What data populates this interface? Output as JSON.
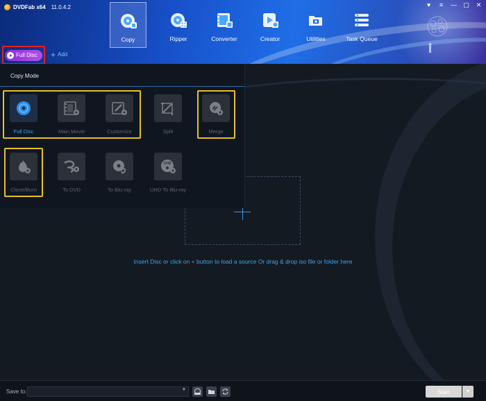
{
  "app": {
    "name": "DVDFab x64",
    "version": "11.0.4.2"
  },
  "window_controls": [
    "♥",
    "≡",
    "—",
    "▢",
    "✕"
  ],
  "nav": {
    "items": [
      {
        "label": "Copy",
        "icon": "copy-disc-icon",
        "active": true
      },
      {
        "label": "Ripper",
        "icon": "ripper-disc-icon",
        "active": false
      },
      {
        "label": "Converter",
        "icon": "converter-film-icon",
        "active": false
      },
      {
        "label": "Creator",
        "icon": "creator-disc-icon",
        "active": false
      },
      {
        "label": "Utilities",
        "icon": "utilities-folder-icon",
        "active": false
      },
      {
        "label": "Task Queue",
        "icon": "task-queue-icon",
        "active": false
      }
    ]
  },
  "toolbar": {
    "mode_button_label": "Full Disc",
    "add_label": "Add"
  },
  "copy_mode": {
    "title": "Copy Mode",
    "modes": [
      {
        "label": "Full Disc",
        "icon": "full-disc-icon",
        "active": true
      },
      {
        "label": "Main Movie",
        "icon": "main-movie-icon",
        "active": false
      },
      {
        "label": "Customize",
        "icon": "customize-icon",
        "active": false
      },
      {
        "label": "Split",
        "icon": "split-icon",
        "active": false
      },
      {
        "label": "Merge",
        "icon": "merge-icon",
        "active": false
      },
      {
        "label": "Clone/Burn",
        "icon": "clone-burn-icon",
        "active": false
      },
      {
        "label": "To DVD",
        "icon": "to-dvd-icon",
        "active": false
      },
      {
        "label": "To Blu-ray",
        "icon": "to-bluray-icon",
        "active": false
      },
      {
        "label": "UHD To Blu-ray",
        "icon": "uhd-to-bluray-icon",
        "active": false
      }
    ]
  },
  "main": {
    "hint": "Insert Disc or click on + button to load a source Or drag & drop iso file or folder here"
  },
  "bottom": {
    "save_label": "Save to:",
    "save_value": "",
    "start_label": "Start"
  },
  "colors": {
    "accent": "#3ea4f0",
    "highlight_box": "#e8c028",
    "red_box": "#e02222",
    "mode_button": "#9a3fe0"
  }
}
